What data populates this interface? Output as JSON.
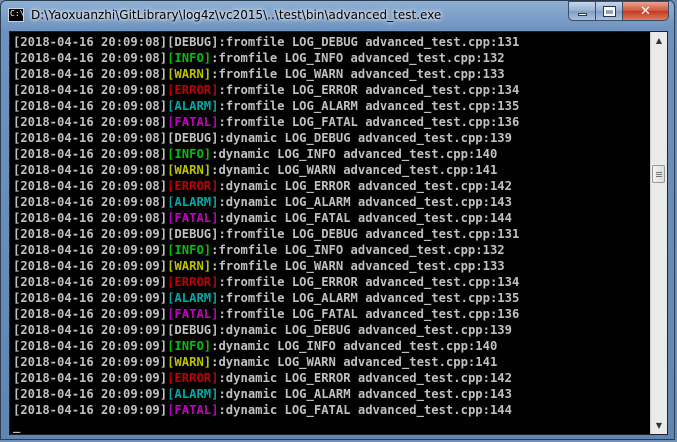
{
  "window": {
    "title": "D:\\Yaoxuanzhi\\GitLibrary\\log4z\\vc2015\\..\\test\\bin\\advanced_test.exe",
    "icon": "console-icon",
    "icon_text": "C:\\"
  },
  "caption_buttons": {
    "minimize": "minimize-icon",
    "maximize": "maximize-icon",
    "close": "✕"
  },
  "scrollbar": {
    "up": "▲",
    "down": "▼",
    "position": 0.33
  },
  "colors": {
    "DEBUG": "#c0c0c0",
    "INFO": "#00c000",
    "WARN": "#c0c000",
    "ERROR": "#c00000",
    "ALARM": "#00a8a8",
    "FATAL": "#c000c0",
    "text": "#c0c0c0",
    "background": "#000000"
  },
  "log_lines": [
    {
      "ts": "[2018-04-16 20:09:08]",
      "level": "[DEBUG]",
      "lvl": "DEBUG",
      "msg": ":fromfile LOG_DEBUG advanced_test.cpp:131"
    },
    {
      "ts": "[2018-04-16 20:09:08]",
      "level": "[INFO]",
      "lvl": "INFO",
      "msg": ":fromfile LOG_INFO advanced_test.cpp:132"
    },
    {
      "ts": "[2018-04-16 20:09:08]",
      "level": "[WARN]",
      "lvl": "WARN",
      "msg": ":fromfile LOG_WARN advanced_test.cpp:133"
    },
    {
      "ts": "[2018-04-16 20:09:08]",
      "level": "[ERROR]",
      "lvl": "ERROR",
      "msg": ":fromfile LOG_ERROR advanced_test.cpp:134"
    },
    {
      "ts": "[2018-04-16 20:09:08]",
      "level": "[ALARM]",
      "lvl": "ALARM",
      "msg": ":fromfile LOG_ALARM advanced_test.cpp:135"
    },
    {
      "ts": "[2018-04-16 20:09:08]",
      "level": "[FATAL]",
      "lvl": "FATAL",
      "msg": ":fromfile LOG_FATAL advanced_test.cpp:136"
    },
    {
      "ts": "[2018-04-16 20:09:08]",
      "level": "[DEBUG]",
      "lvl": "DEBUG",
      "msg": ":dynamic LOG_DEBUG advanced_test.cpp:139"
    },
    {
      "ts": "[2018-04-16 20:09:08]",
      "level": "[INFO]",
      "lvl": "INFO",
      "msg": ":dynamic LOG_INFO advanced_test.cpp:140"
    },
    {
      "ts": "[2018-04-16 20:09:08]",
      "level": "[WARN]",
      "lvl": "WARN",
      "msg": ":dynamic LOG_WARN advanced_test.cpp:141"
    },
    {
      "ts": "[2018-04-16 20:09:08]",
      "level": "[ERROR]",
      "lvl": "ERROR",
      "msg": ":dynamic LOG_ERROR advanced_test.cpp:142"
    },
    {
      "ts": "[2018-04-16 20:09:08]",
      "level": "[ALARM]",
      "lvl": "ALARM",
      "msg": ":dynamic LOG_ALARM advanced_test.cpp:143"
    },
    {
      "ts": "[2018-04-16 20:09:08]",
      "level": "[FATAL]",
      "lvl": "FATAL",
      "msg": ":dynamic LOG_FATAL advanced_test.cpp:144"
    },
    {
      "ts": "[2018-04-16 20:09:09]",
      "level": "[DEBUG]",
      "lvl": "DEBUG",
      "msg": ":fromfile LOG_DEBUG advanced_test.cpp:131"
    },
    {
      "ts": "[2018-04-16 20:09:09]",
      "level": "[INFO]",
      "lvl": "INFO",
      "msg": ":fromfile LOG_INFO advanced_test.cpp:132"
    },
    {
      "ts": "[2018-04-16 20:09:09]",
      "level": "[WARN]",
      "lvl": "WARN",
      "msg": ":fromfile LOG_WARN advanced_test.cpp:133"
    },
    {
      "ts": "[2018-04-16 20:09:09]",
      "level": "[ERROR]",
      "lvl": "ERROR",
      "msg": ":fromfile LOG_ERROR advanced_test.cpp:134"
    },
    {
      "ts": "[2018-04-16 20:09:09]",
      "level": "[ALARM]",
      "lvl": "ALARM",
      "msg": ":fromfile LOG_ALARM advanced_test.cpp:135"
    },
    {
      "ts": "[2018-04-16 20:09:09]",
      "level": "[FATAL]",
      "lvl": "FATAL",
      "msg": ":fromfile LOG_FATAL advanced_test.cpp:136"
    },
    {
      "ts": "[2018-04-16 20:09:09]",
      "level": "[DEBUG]",
      "lvl": "DEBUG",
      "msg": ":dynamic LOG_DEBUG advanced_test.cpp:139"
    },
    {
      "ts": "[2018-04-16 20:09:09]",
      "level": "[INFO]",
      "lvl": "INFO",
      "msg": ":dynamic LOG_INFO advanced_test.cpp:140"
    },
    {
      "ts": "[2018-04-16 20:09:09]",
      "level": "[WARN]",
      "lvl": "WARN",
      "msg": ":dynamic LOG_WARN advanced_test.cpp:141"
    },
    {
      "ts": "[2018-04-16 20:09:09]",
      "level": "[ERROR]",
      "lvl": "ERROR",
      "msg": ":dynamic LOG_ERROR advanced_test.cpp:142"
    },
    {
      "ts": "[2018-04-16 20:09:09]",
      "level": "[ALARM]",
      "lvl": "ALARM",
      "msg": ":dynamic LOG_ALARM advanced_test.cpp:143"
    },
    {
      "ts": "[2018-04-16 20:09:09]",
      "level": "[FATAL]",
      "lvl": "FATAL",
      "msg": ":dynamic LOG_FATAL advanced_test.cpp:144"
    }
  ],
  "cursor": "_"
}
